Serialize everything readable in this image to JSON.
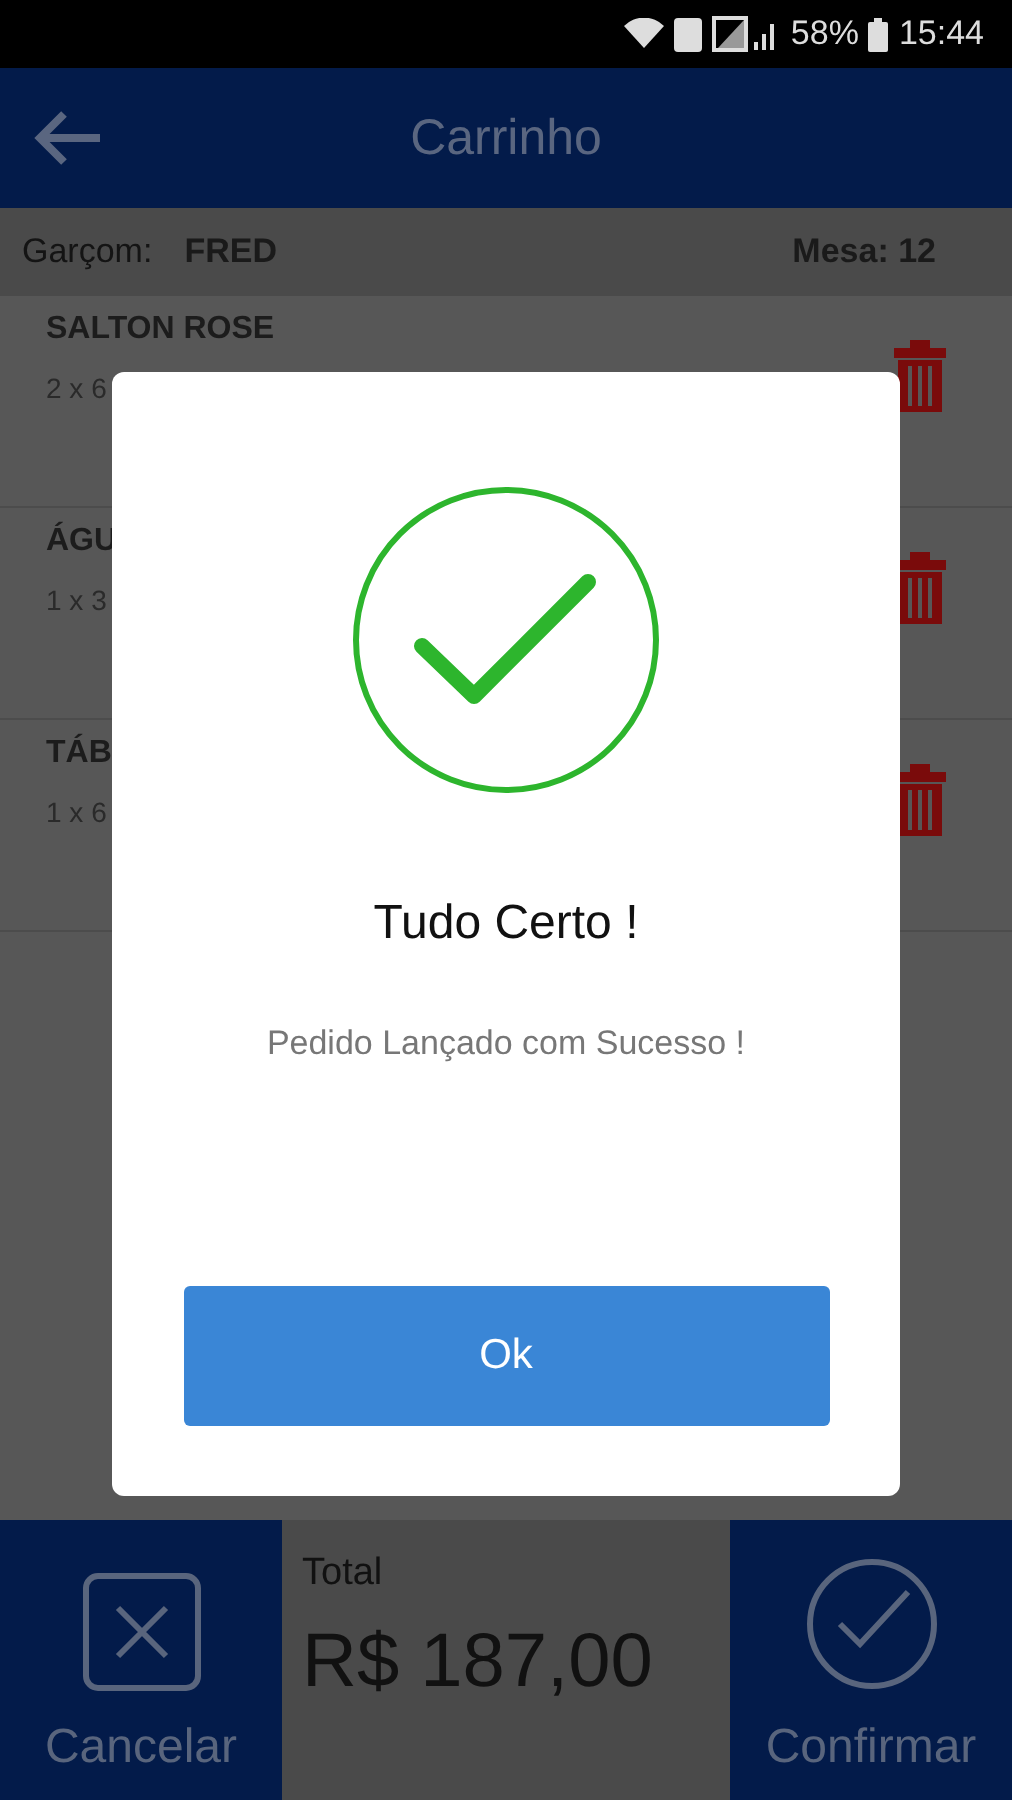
{
  "status_bar": {
    "battery": "58%",
    "time": "15:44"
  },
  "header": {
    "title": "Carrinho"
  },
  "info": {
    "waiter_label": "Garçom:",
    "waiter": "FRED",
    "table": "Mesa: 12"
  },
  "items": [
    {
      "name": "SALTON ROSE",
      "detail": "2 x 6"
    },
    {
      "name": "ÁGU",
      "detail": "1 x 3"
    },
    {
      "name": "TÁB",
      "detail": "1 x 6"
    }
  ],
  "footer": {
    "cancel": "Cancelar",
    "total_label": "Total",
    "total": "R$ 187,00",
    "confirm": "Confirmar"
  },
  "dialog": {
    "title": "Tudo Certo !",
    "message": "Pedido Lançado com Sucesso !",
    "button": "Ok"
  }
}
